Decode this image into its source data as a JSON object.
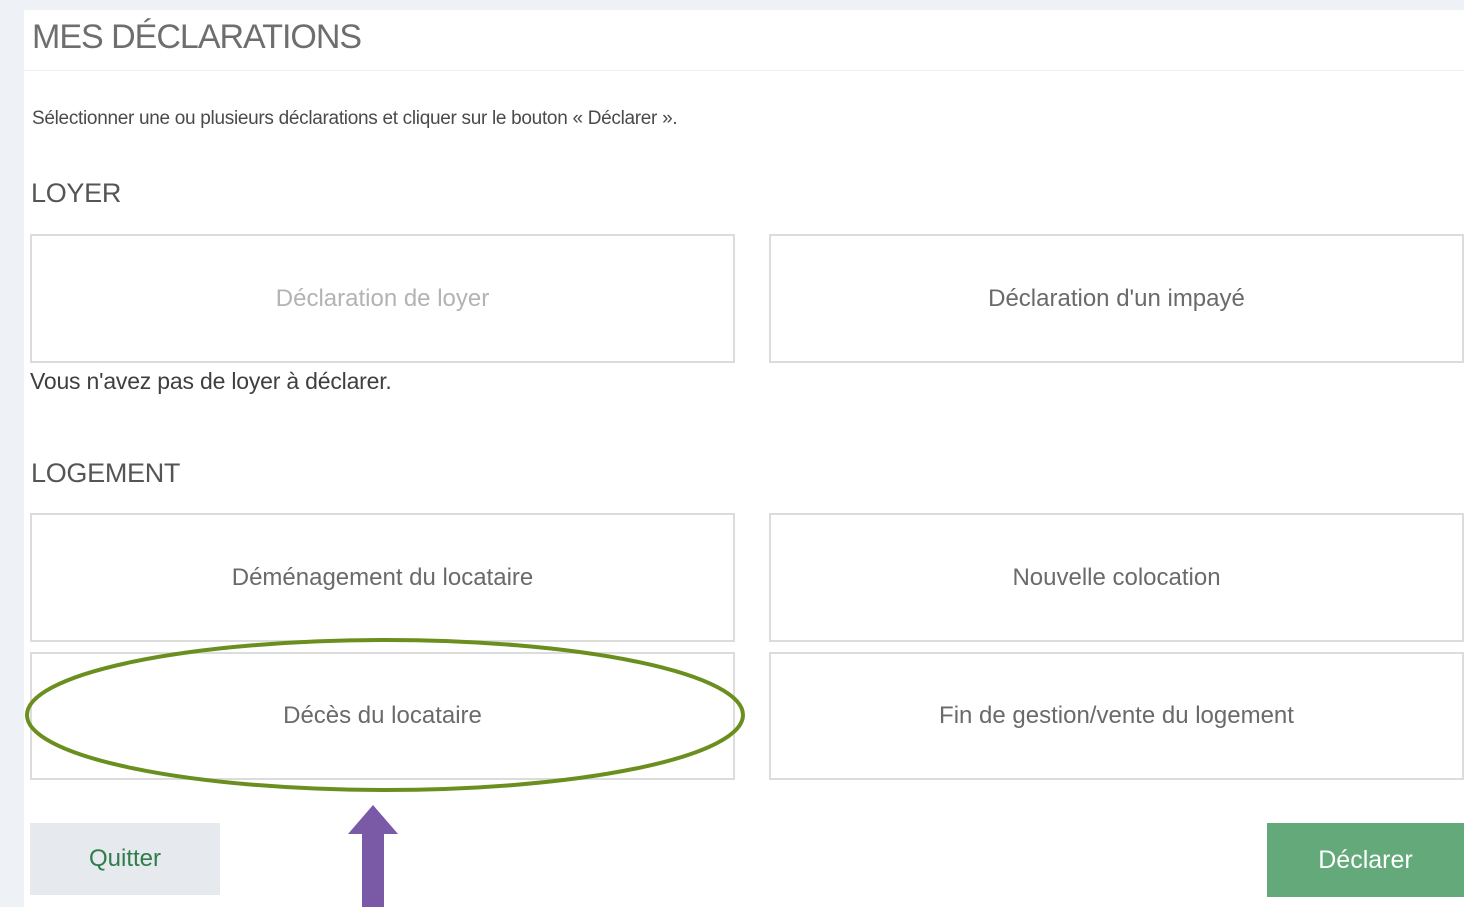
{
  "page": {
    "title": "MES DÉCLARATIONS",
    "instruction": "Sélectionner une ou plusieurs déclarations et cliquer sur le bouton « Déclarer ».",
    "colors": {
      "background": "#eef1f5",
      "panel": "#ffffff",
      "accent_green": "#63a97a",
      "highlight_ellipse": "#6b8f1e",
      "annotation_arrow": "#7a5aa6"
    }
  },
  "sections": {
    "loyer": {
      "title": "LOYER",
      "cards": [
        {
          "label": "Déclaration de loyer",
          "state": "disabled"
        },
        {
          "label": "Déclaration d'un impayé",
          "state": "enabled"
        }
      ],
      "note": "Vous n'avez pas de loyer à déclarer."
    },
    "logement": {
      "title": "LOGEMENT",
      "cards": [
        {
          "label": "Déménagement du locataire",
          "state": "enabled"
        },
        {
          "label": "Nouvelle colocation",
          "state": "enabled"
        },
        {
          "label": "Décès du locataire",
          "state": "enabled",
          "highlighted": true
        },
        {
          "label": "Fin de gestion/vente du logement",
          "state": "enabled"
        }
      ]
    }
  },
  "actions": {
    "quit_label": "Quitter",
    "declare_label": "Déclarer"
  },
  "annotations": {
    "highlight": "ellipse around Décès du locataire",
    "arrow": "arrow-up-icon"
  }
}
